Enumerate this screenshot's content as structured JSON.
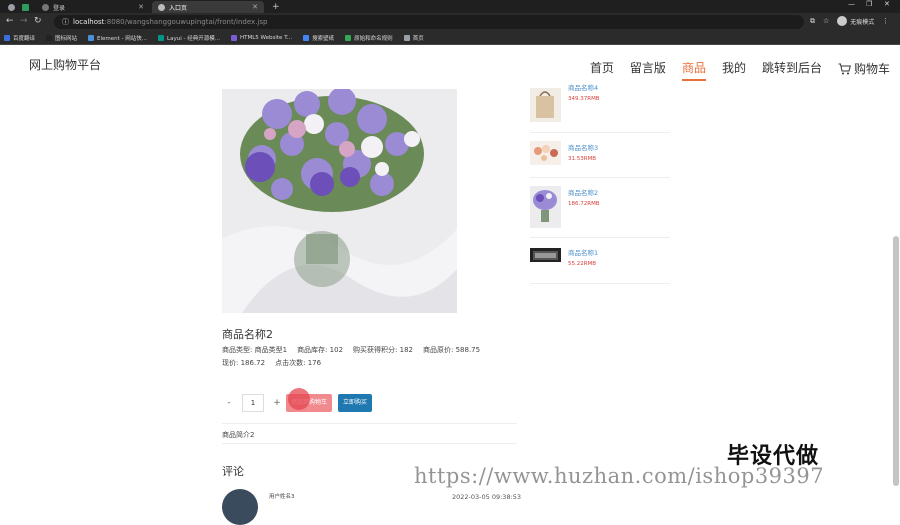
{
  "browser": {
    "tabs": [
      {
        "label": "",
        "active": false
      },
      {
        "label": "登录",
        "active": false
      },
      {
        "label": "入口页",
        "active": true
      }
    ],
    "url_host": "localhost",
    "url_rest": ":8080/wangshanggouwupingtai/front/index.jsp",
    "profile_label": "无痕模式",
    "bookmarks": [
      {
        "label": "百度翻译",
        "color": "#3b6fe0"
      },
      {
        "label": "图标网站",
        "color": "#222222"
      },
      {
        "label": "Element - 网站快...",
        "color": "#4a90d9"
      },
      {
        "label": "Layui - 经典开源模...",
        "color": "#009688"
      },
      {
        "label": "HTML5 Website T...",
        "color": "#7b5cd6"
      },
      {
        "label": "搜索壁纸",
        "color": "#4285f4"
      },
      {
        "label": "原始和命名规则",
        "color": "#34a853"
      },
      {
        "label": "首页",
        "color": "#9aa0a6"
      }
    ]
  },
  "header": {
    "brand": "网上购物平台",
    "nav": [
      {
        "label": "首页",
        "active": false
      },
      {
        "label": "留言版",
        "active": false
      },
      {
        "label": "商品",
        "active": true
      },
      {
        "label": "我的",
        "active": false
      },
      {
        "label": "跳转到后台",
        "active": false
      }
    ],
    "cart_label": "购物车"
  },
  "product": {
    "name": "商品名称2",
    "type_label": "商品类型:",
    "type_value": "商品类型1",
    "stock_label": "商品库存:",
    "stock_value": "102",
    "points_label": "购买获得积分:",
    "points_value": "182",
    "orig_price_label": "商品原价:",
    "orig_price_value": "588.75",
    "price_label": "现价:",
    "price_value": "186.72",
    "clicks_label": "点击次数:",
    "clicks_value": "176",
    "quantity": "1",
    "minus": "-",
    "plus": "+",
    "add_cart_label": "添加到购物车",
    "buy_label": "立即购买",
    "intro": "商品简介2"
  },
  "comments": {
    "title": "评论",
    "items": [
      {
        "user": "用户姓名3",
        "time": "2022-03-05 09:38:53"
      }
    ]
  },
  "sidebar": {
    "items": [
      {
        "name": "商品名称4",
        "price": "349.37RMB",
        "thumb": "bag"
      },
      {
        "name": "商品名称3",
        "price": "31.53RMB",
        "thumb": "cake"
      },
      {
        "name": "商品名称2",
        "price": "186.72RMB",
        "thumb": "flower"
      },
      {
        "name": "商品名称1",
        "price": "55.22RMB",
        "thumb": "laptop"
      }
    ]
  },
  "watermark": {
    "top": "毕设代做",
    "url": "https://www.huzhan.com/ishop39397"
  },
  "colors": {
    "accent": "#e8703a",
    "link": "#4a8ec8",
    "price": "#d9413c",
    "cart_button": "#f08a8f",
    "buy_button": "#1f78b0"
  }
}
